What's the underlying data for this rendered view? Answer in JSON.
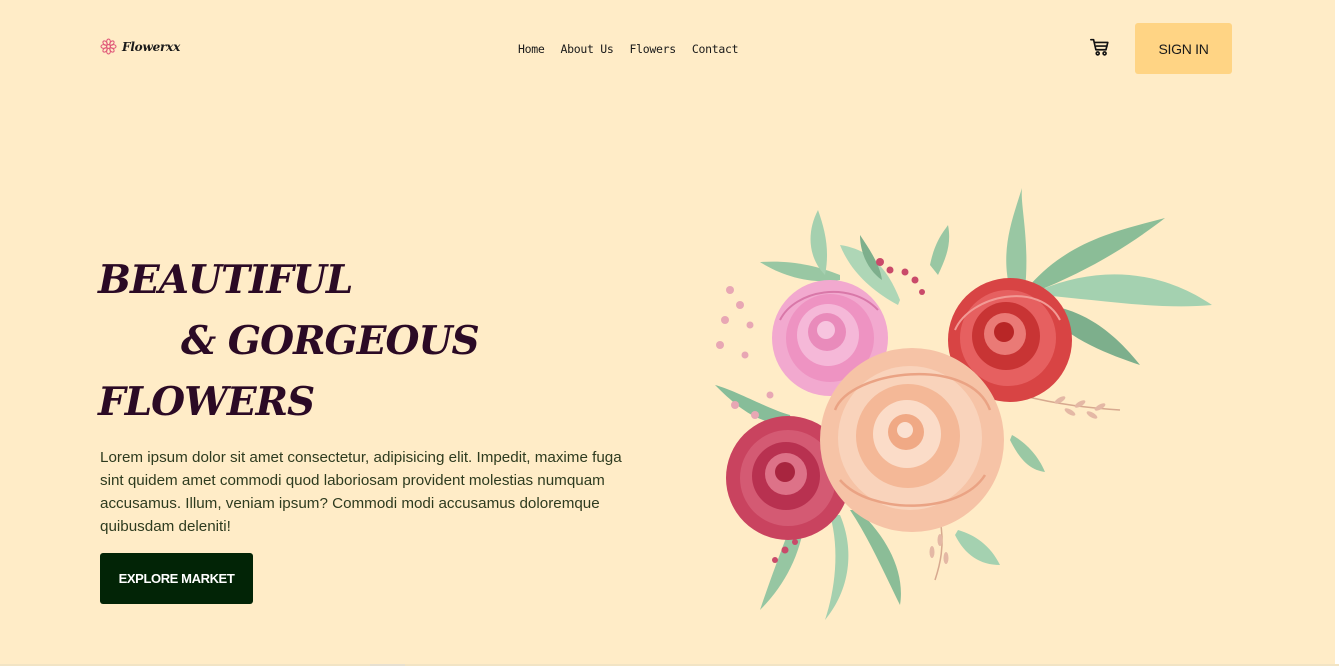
{
  "header": {
    "logo_text": "Flowerxx",
    "logo_icon": "flower-icon",
    "nav": [
      {
        "label": "Home"
      },
      {
        "label": "About Us"
      },
      {
        "label": "Flowers"
      },
      {
        "label": "Contact"
      }
    ],
    "cart_icon": "cart-icon",
    "signin_label": "SIGN IN"
  },
  "hero": {
    "title_line1": "BEAUTIFUL",
    "title_line2": "& GORGEOUS",
    "title_line3": "FLOWERS",
    "description": "Lorem ipsum dolor sit amet consectetur, adipisicing elit. Impedit, maxime fuga sint quidem amet commodi quod laboriosam provident molestias numquam accusamus. Illum, veniam ipsum? Commodi modi accusamus doloremque quibusdam deleniti!",
    "cta_label": "EXPLORE MARKET",
    "image": "flower-bouquet-illustration"
  },
  "colors": {
    "background": "#ffecc7",
    "signin_bg": "#ffd484",
    "cta_bg": "#022406",
    "title": "#2b0a25",
    "brand_accent": "#e05a7a"
  }
}
